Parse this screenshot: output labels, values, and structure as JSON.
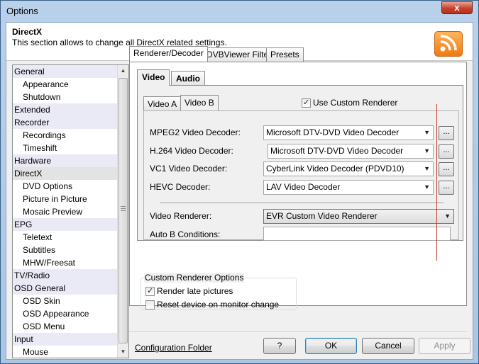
{
  "window": {
    "title": "Options",
    "close_label": "x"
  },
  "header": {
    "title": "DirectX",
    "description": "This section allows to change all DirectX related settings.",
    "icon": "rss-icon"
  },
  "nav": {
    "items": [
      {
        "label": "General",
        "level": 0
      },
      {
        "label": "Appearance",
        "level": 1
      },
      {
        "label": "Shutdown",
        "level": 1
      },
      {
        "label": "Extended",
        "level": 0
      },
      {
        "label": "Recorder",
        "level": 0
      },
      {
        "label": "Recordings",
        "level": 1
      },
      {
        "label": "Timeshift",
        "level": 1
      },
      {
        "label": "Hardware",
        "level": 0
      },
      {
        "label": "DirectX",
        "level": 0,
        "selected": true
      },
      {
        "label": "DVD Options",
        "level": 1
      },
      {
        "label": "Picture in Picture",
        "level": 1
      },
      {
        "label": "Mosaic Preview",
        "level": 1
      },
      {
        "label": "EPG",
        "level": 0
      },
      {
        "label": "Teletext",
        "level": 1
      },
      {
        "label": "Subtitles",
        "level": 1
      },
      {
        "label": "MHW/Freesat",
        "level": 1
      },
      {
        "label": "TV/Radio",
        "level": 0
      },
      {
        "label": "OSD General",
        "level": 0
      },
      {
        "label": "OSD Skin",
        "level": 1
      },
      {
        "label": "OSD Appearance",
        "level": 1
      },
      {
        "label": "OSD Menu",
        "level": 1
      },
      {
        "label": "Input",
        "level": 0
      },
      {
        "label": "Mouse",
        "level": 1
      }
    ]
  },
  "main_tabs": {
    "renderer_decoder": "Renderer/Decoder",
    "dvbviewer_filter": "DVBViewer Filter",
    "presets": "Presets"
  },
  "media_tabs": {
    "video": "Video",
    "audio": "Audio"
  },
  "video_tabs": {
    "video_a": "Video A",
    "video_b": "Video B"
  },
  "use_custom_renderer": {
    "label": "Use Custom Renderer",
    "checked": true
  },
  "decoders": {
    "mpeg2": {
      "label": "MPEG2 Video Decoder:",
      "value": "Microsoft DTV-DVD Video Decoder",
      "button": "..."
    },
    "h264": {
      "label": "H.264 Video Decoder:",
      "value": "Microsoft DTV-DVD Video Decoder",
      "button": "..."
    },
    "vc1": {
      "label": "VC1 Video Decoder:",
      "value": "CyberLink Video Decoder (PDVD10)",
      "button": "..."
    },
    "hevc": {
      "label": "HEVC Decoder:",
      "value": "LAV Video Decoder",
      "button": "..."
    }
  },
  "video_renderer": {
    "label": "Video Renderer:",
    "value": "EVR Custom Video Renderer"
  },
  "auto_b_conditions": {
    "label": "Auto B Conditions:",
    "value": ""
  },
  "custom_renderer_options": {
    "title": "Custom Renderer Options",
    "render_late": {
      "label": "Render late pictures",
      "checked": true
    },
    "reset_device": {
      "label": "Reset device on monitor change",
      "checked": false
    }
  },
  "footer": {
    "config_folder": "Configuration Folder",
    "help": "?",
    "ok": "OK",
    "cancel": "Cancel",
    "apply": "Apply"
  }
}
